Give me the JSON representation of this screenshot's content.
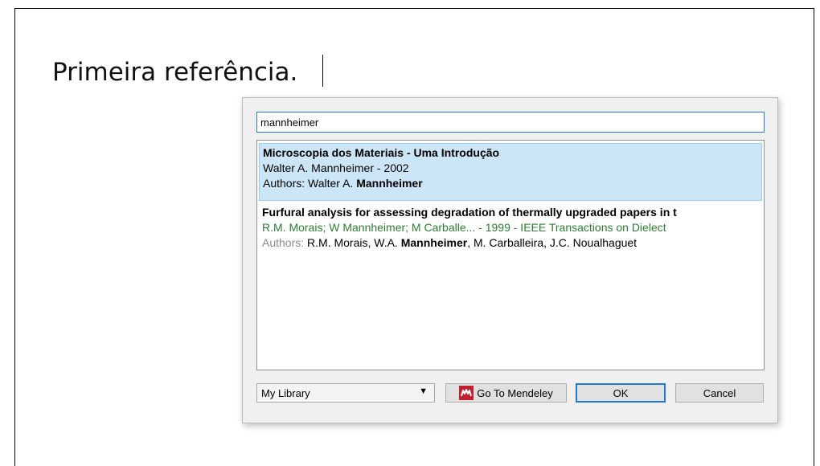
{
  "document": {
    "text": "Primeira referência."
  },
  "dialog": {
    "search": {
      "value": "mannheimer"
    },
    "results": [
      {
        "title": "Microscopia dos Materiais - Uma Introdução",
        "meta": "Walter A. Mannheimer - 2002",
        "authors_label": "Authors: ",
        "authors_plain": "Walter A. ",
        "authors_bold": "Mannheimer",
        "authors_after": ""
      },
      {
        "title": "Furfural analysis for assessing degradation of thermally upgraded papers in t",
        "meta": "R.M. Morais; W Mannheimer; M Carballe... - 1999 - IEEE Transactions on Dielect",
        "authors_label": "Authors: ",
        "authors_plain": "R.M. Morais, W.A. ",
        "authors_bold": "Mannheimer",
        "authors_after": ", M. Carballeira, J.C. Noualhaguet"
      }
    ],
    "library_select": {
      "value": "My Library"
    },
    "buttons": {
      "go_to_mendeley": "Go To Mendeley",
      "ok": "OK",
      "cancel": "Cancel"
    },
    "colors": {
      "selection": "#cde6f7",
      "meta_green": "#2e7d32",
      "focus_blue": "#1e7ad6",
      "mendeley_red": "#c2202f"
    }
  }
}
